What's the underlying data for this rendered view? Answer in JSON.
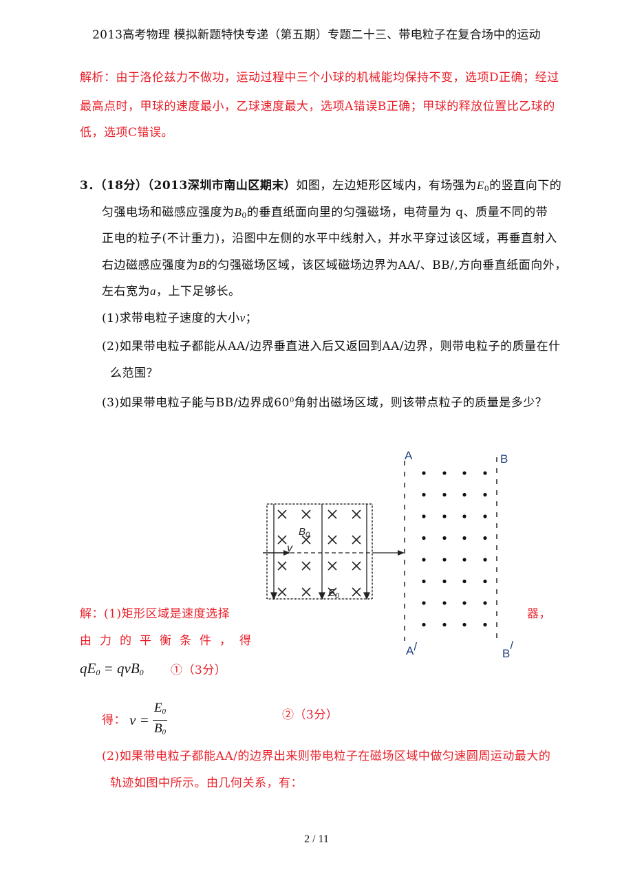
{
  "header": {
    "title": "2013高考物理 模拟新题特快专递（第五期）专题二十三、带电粒子在复合场中的运动"
  },
  "analysis": {
    "lines": [
      "解析：由于洛伦兹力不做功，运动过程中三个小球的机械能均保持不变，选项D正确；经过",
      "最高点时，甲球的速度最小，乙球速度最大，选项A错误B正确；甲球的释放位置比乙球的",
      "低，选项C错误。"
    ]
  },
  "question": {
    "number": "3．",
    "score": "（18分）",
    "source": "（2013深圳市南山区期末）",
    "line1_a": "如图，左边矩形区域内，有场强为",
    "E0": "E",
    "E0_sub": "0",
    "line1_b": "的竖直向下的",
    "line2_a": "匀强电场和磁感应强度为",
    "B0": "B",
    "B0_sub": "0",
    "line2_b": "的垂直纸面向里的匀强磁场，电荷量为 q、质量不同的带",
    "line3": "正电的粒子(不计重力)，沿图中左侧的水平中线射入，并水平穿过该区域，再垂直射入",
    "line4_a": "右边磁感应强度为",
    "B": "B",
    "line4_b": "的匀强磁场区域，该区域磁场边界为AA/、BB/,方向垂直纸面向外，",
    "line5_a": "左右宽为",
    "a": "a",
    "line5_b": "，上下足够长。",
    "sub1_a": "(1)求带电粒子速度的大小",
    "v": "v",
    "sub1_b": "；",
    "sub2_line1": "(2)如果带电粒子都能从AA/边界垂直进入后又返回到AA/边界，则带电粒子的质量在什",
    "sub2_line2": "么范围？",
    "sub3_a": "(3)如果带电粒子能与BB/边界成60",
    "sub3_sup": "0",
    "sub3_b": "角射出磁场区域，则该带点粒子的质量是多少？"
  },
  "figure": {
    "label_B0": "B",
    "label_B0_sub": "0",
    "label_E0": "E",
    "label_E0_sub": "0",
    "label_v": "v",
    "label_A": "A",
    "label_B": "B",
    "label_A_prime": "A",
    "label_B_prime": "B",
    "prime": "/",
    "inward_symbol": "×",
    "outward_symbol": "•"
  },
  "solution": {
    "line1_a": "解：(1)矩形区域是速度选择",
    "line1_b": "器，",
    "line2": "由力的平衡条件，得",
    "eq1_lhs": "qE",
    "eq1_sub": "0",
    "eq1_mid": " = qvB",
    "eq1_sub2": "0",
    "eq1_tag": "①（3分）",
    "eq2_prefix": "得：",
    "eq2_v": "v =",
    "eq2_num": "E",
    "eq2_num_sub": "0",
    "eq2_den": "B",
    "eq2_den_sub": "0",
    "eq2_tag": "②（3分）",
    "part2_line1": "(2)如果带电粒子都能AA/的边界出来则带电粒子在磁场区域中做匀速圆周运动最大的",
    "part2_line2": "轨迹如图中所示。由几何关系，有："
  },
  "footer": {
    "page": "2 / 11"
  }
}
